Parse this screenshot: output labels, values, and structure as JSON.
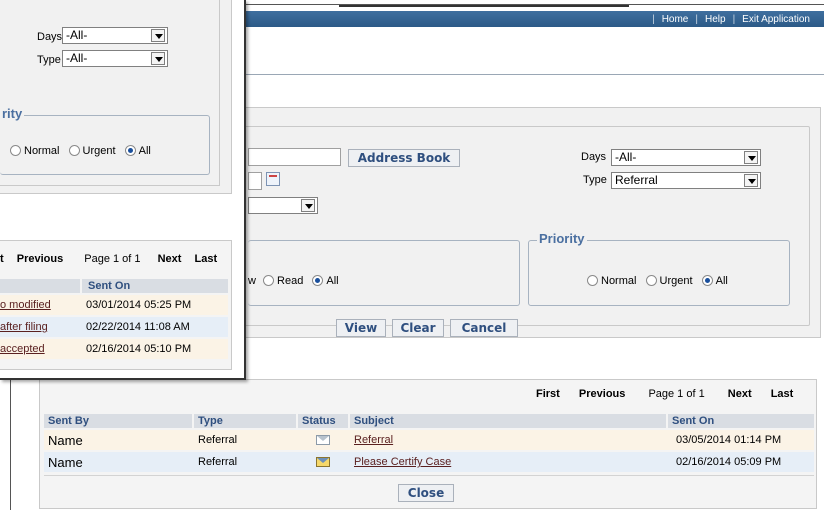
{
  "top_nav": {
    "home": "Home",
    "help": "Help",
    "exit": "Exit Application"
  },
  "search": {
    "address_book": "Address Book",
    "days_label": "Days",
    "days_value": "-All-",
    "type_label": "Type",
    "type_value": "Referral",
    "read_partial": "w",
    "read_label": "Read",
    "all_label": "All",
    "priority_legend": "Priority",
    "normal_label": "Normal",
    "urgent_label": "Urgent",
    "priority_all_label": "All",
    "view_button": "View",
    "clear_button": "Clear",
    "cancel_button": "Cancel"
  },
  "results": {
    "pager": {
      "first": "First",
      "previous": "Previous",
      "page": "Page 1 of 1",
      "next": "Next",
      "last": "Last"
    },
    "headers": {
      "sent_by": "Sent By",
      "type": "Type",
      "status": "Status",
      "subject": "Subject",
      "sent_on": "Sent On"
    },
    "rows": [
      {
        "sent_by": "Name",
        "type": "Referral",
        "status_icon": "envelope-closed-icon",
        "subject": "Referral",
        "sent_on": "03/05/2014 01:14 PM"
      },
      {
        "sent_by": "Name",
        "type": "Referral",
        "status_icon": "envelope-open-icon",
        "subject": "Please Certify Case",
        "sent_on": "02/16/2014 05:09 PM"
      }
    ],
    "close_button": "Close"
  },
  "front_window": {
    "days_label": "Days",
    "days_value": "-All-",
    "type_label": "Type",
    "type_value": "-All-",
    "priority_partial": "rity",
    "normal_label": "Normal",
    "urgent_label": "Urgent",
    "all_label": "All",
    "pager": {
      "first_partial": "t",
      "previous": "Previous",
      "page": "Page 1 of 1",
      "next": "Next",
      "last": "Last"
    },
    "sent_on_header": "Sent On",
    "rows": [
      {
        "subject_partial": "o modified",
        "sent_on": "03/01/2014 05:25 PM"
      },
      {
        "subject_partial": "after filing",
        "sent_on": "02/22/2014 11:08 AM"
      },
      {
        "subject_partial": "accepted",
        "sent_on": "02/16/2014 05:10 PM"
      }
    ]
  },
  "colors": {
    "topbar": "#2c5a87",
    "header_text": "#2f4f7f",
    "legend": "#4a6fa0",
    "row_odd": "#fbf3e6",
    "row_even": "#e6eef7"
  }
}
